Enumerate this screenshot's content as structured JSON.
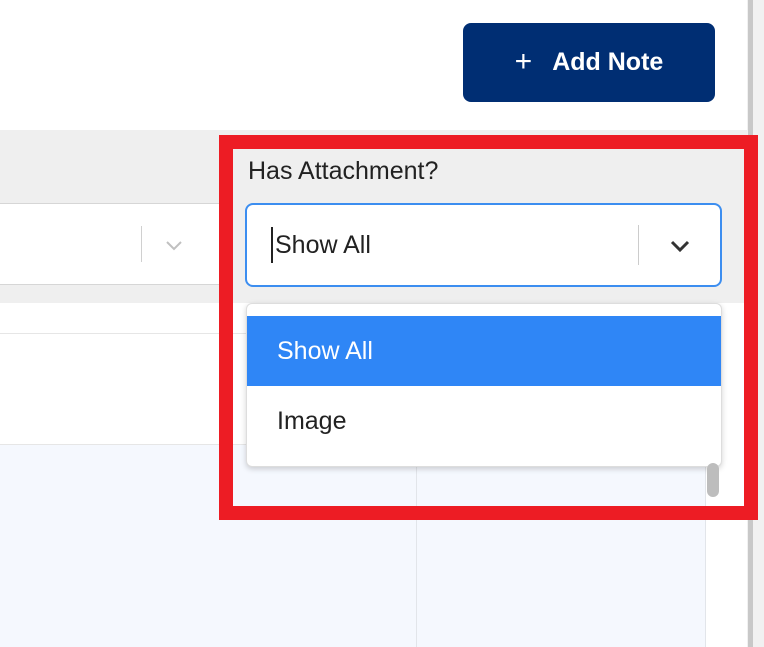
{
  "header": {
    "add_note_plus": "+",
    "add_note_label": "Add Note"
  },
  "filter": {
    "label": "Has Attachment?",
    "selected_value": "Show All",
    "options": [
      "Show All",
      "Image"
    ],
    "highlighted_option": "Show All"
  },
  "icons": {
    "plus": "plus-icon",
    "chevron": "chevron-down-icon"
  },
  "colors": {
    "primary_button": "#002e73",
    "focus_border": "#3c8ef0",
    "option_highlight": "#2f86f6",
    "annotation_box": "#ed1c24"
  }
}
